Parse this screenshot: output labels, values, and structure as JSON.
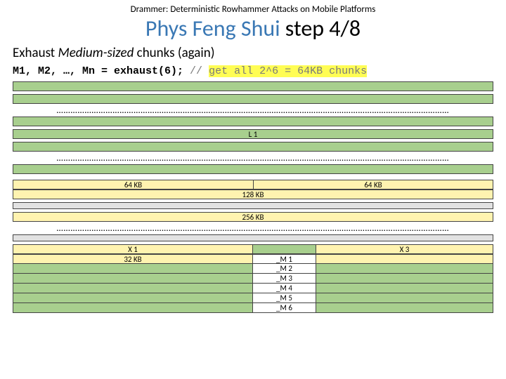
{
  "slide": {
    "supertitle": "Drammer: Deterministic Rowhammer Attacks on Mobile Platforms",
    "title_accent": "Phys Feng Shui",
    "title_rest": " step 4/8",
    "subheading_prefix": "Exhaust ",
    "subheading_em": "Medium-sized",
    "subheading_suffix": " chunks (again)",
    "code": {
      "stmt": "M1, M2, …, Mn = exhaust(6);",
      "comment_prefix": " // ",
      "comment_hl": "get all 2^6 = 64KB chunks"
    },
    "dots": "……………………………………………………………………………………………………………………………………………………"
  },
  "labels": {
    "L1": "L 1",
    "s64a": "64 KB",
    "s64b": "64 KB",
    "s128": "128 KB",
    "s256": "256 KB",
    "X1": "X 1",
    "X3": "X 3",
    "s32": "32 KB",
    "M1": "_M 1",
    "M2": "_M 2",
    "M3": "_M 3",
    "M4": "_M 4",
    "M5": "_M 5",
    "M6": "_M 6"
  }
}
